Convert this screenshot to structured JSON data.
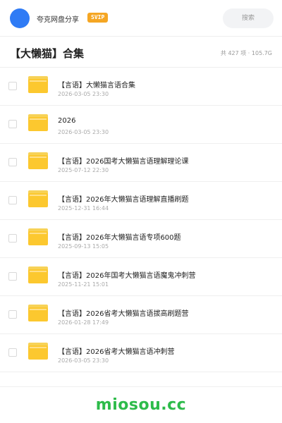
{
  "header": {
    "app_name": "夸克网盘分享",
    "badge": "SVIP",
    "search_label": "搜索",
    "avatar_color": "#2f7bf5"
  },
  "title_bar": {
    "title": "【大懒猫】合集",
    "meta": "共 427 项 · 105.7G"
  },
  "folder_icon": "folder-icon",
  "items": [
    {
      "name": "【言语】大懒猫言语合集",
      "date": "2026-03-05 23:30"
    },
    {
      "name": "2026",
      "date": "2026-03-05 23:30"
    },
    {
      "name": "【言语】2026国考大懒猫言语理解理论课",
      "date": "2025-07-12 22:30"
    },
    {
      "name": "【言语】2026年大懒猫言语理解直播刷题",
      "date": "2025-12-31 16:44"
    },
    {
      "name": "【言语】2026年大懒猫言语专项600题",
      "date": "2025-09-13 15:05"
    },
    {
      "name": "【言语】2026年国考大懒猫言语魔鬼冲刺营",
      "date": "2025-11-21 15:01"
    },
    {
      "name": "【言语】2026省考大懒猫言语拔高刷题营",
      "date": "2026-01-28 17:49"
    },
    {
      "name": "【言语】2026省考大懒猫言语冲刺营",
      "date": "2026-03-05 23:30"
    }
  ],
  "watermark": "miosou.cc",
  "colors": {
    "accent_blue": "#2f7bf5",
    "svip_orange": "#f5a623",
    "folder_yellow": "#fcc82f",
    "watermark_green": "#2dbb4a"
  }
}
